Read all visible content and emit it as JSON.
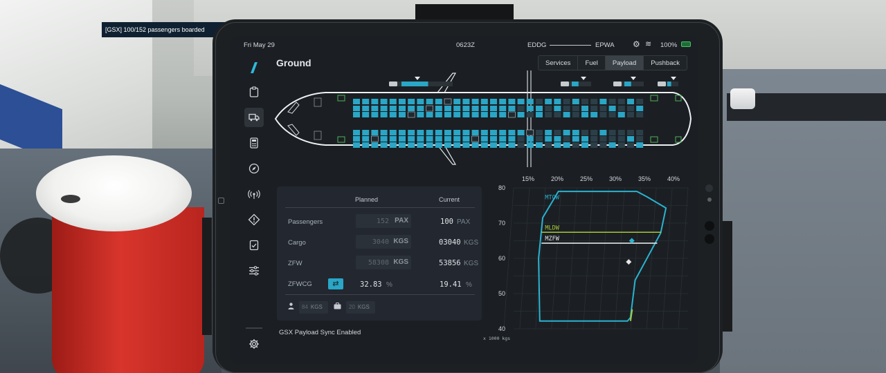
{
  "toast": {
    "text": "[GSX] 100/152 passengers boarded"
  },
  "status_bar": {
    "date": "Fri May 29",
    "zulu_time": "0623Z",
    "departure": "EDDG",
    "arrival": "EPWA",
    "battery": "100%",
    "icons": [
      "gear-icon",
      "wifi-icon",
      "battery-icon"
    ]
  },
  "sidebar": {
    "items": [
      {
        "icon": "clipboard-icon",
        "glyph": "📋"
      },
      {
        "icon": "truck-icon",
        "glyph": "🚚",
        "active": true
      },
      {
        "icon": "calculator-icon",
        "glyph": "🖩"
      },
      {
        "icon": "compass-icon",
        "glyph": "🧭"
      },
      {
        "icon": "radio-icon",
        "glyph": "((•))"
      },
      {
        "icon": "warning-icon",
        "glyph": "⚠"
      },
      {
        "icon": "checklist-icon",
        "glyph": "☑"
      },
      {
        "icon": "sliders-icon",
        "glyph": "☰"
      }
    ],
    "settings": {
      "icon": "settings-icon",
      "glyph": "⚙"
    }
  },
  "page": {
    "title": "Ground"
  },
  "tabs": [
    {
      "label": "Services",
      "active": false
    },
    {
      "label": "Fuel",
      "active": false
    },
    {
      "label": "Payload",
      "active": true
    },
    {
      "label": "Pushback",
      "active": false
    }
  ],
  "payload": {
    "headers": {
      "planned": "Planned",
      "current": "Current"
    },
    "rows": [
      {
        "label": "Passengers",
        "planned": "152",
        "planned_unit": "PAX",
        "current": "100",
        "current_unit": "PAX"
      },
      {
        "label": "Cargo",
        "planned": "3040",
        "planned_unit": "KGS",
        "current": "03040",
        "current_unit": "KGS"
      },
      {
        "label": "ZFW",
        "planned": "58308",
        "planned_unit": "KGS",
        "current": "53856",
        "current_unit": "KGS"
      }
    ],
    "zfwcg": {
      "label": "ZFWCG",
      "planned": "32.83",
      "planned_unit": "%",
      "current": "19.41",
      "current_unit": "%"
    },
    "per_pax": {
      "value": "84",
      "unit": "KGS"
    },
    "per_bag": {
      "value": "20",
      "unit": "KGS"
    }
  },
  "gsx_sync": "GSX Payload Sync Enabled",
  "colors": {
    "accent": "#2aa6c6",
    "limit_line": "#2ab3d1",
    "mldw": "#a7c93a",
    "screen_bg": "#1b1f23"
  },
  "seatmap": {
    "forward_cargo": 0.55,
    "aft_cargo_1": 0.35,
    "aft_cargo_2": 0.35,
    "aft_cargo_3": 0.35
  },
  "chart_data": {
    "type": "scatter",
    "title": "",
    "xlabel": "",
    "ylabel": "",
    "top_axis_ticks": [
      "15%",
      "20%",
      "25%",
      "30%",
      "35%",
      "40%"
    ],
    "y_ticks": [
      "80",
      "70",
      "60",
      "50",
      "40"
    ],
    "y_unit_label": "x 1000 kgs",
    "ylim": [
      40,
      80
    ],
    "limit_labels": [
      "MTOW",
      "MLDW",
      "MZFW"
    ],
    "limits": [
      {
        "name": "MTOW",
        "weight": 79
      },
      {
        "name": "MLDW",
        "weight": 67.4
      },
      {
        "name": "MZFW",
        "weight": 64.3
      }
    ],
    "points": [
      {
        "label": "planned",
        "cg": 32.83,
        "weight": 65.0,
        "shape": "diamond",
        "color": "#2ab3d1"
      },
      {
        "label": "current",
        "cg": 32.3,
        "weight": 59.0,
        "shape": "diamond",
        "color": "#e6e6e6"
      }
    ]
  }
}
